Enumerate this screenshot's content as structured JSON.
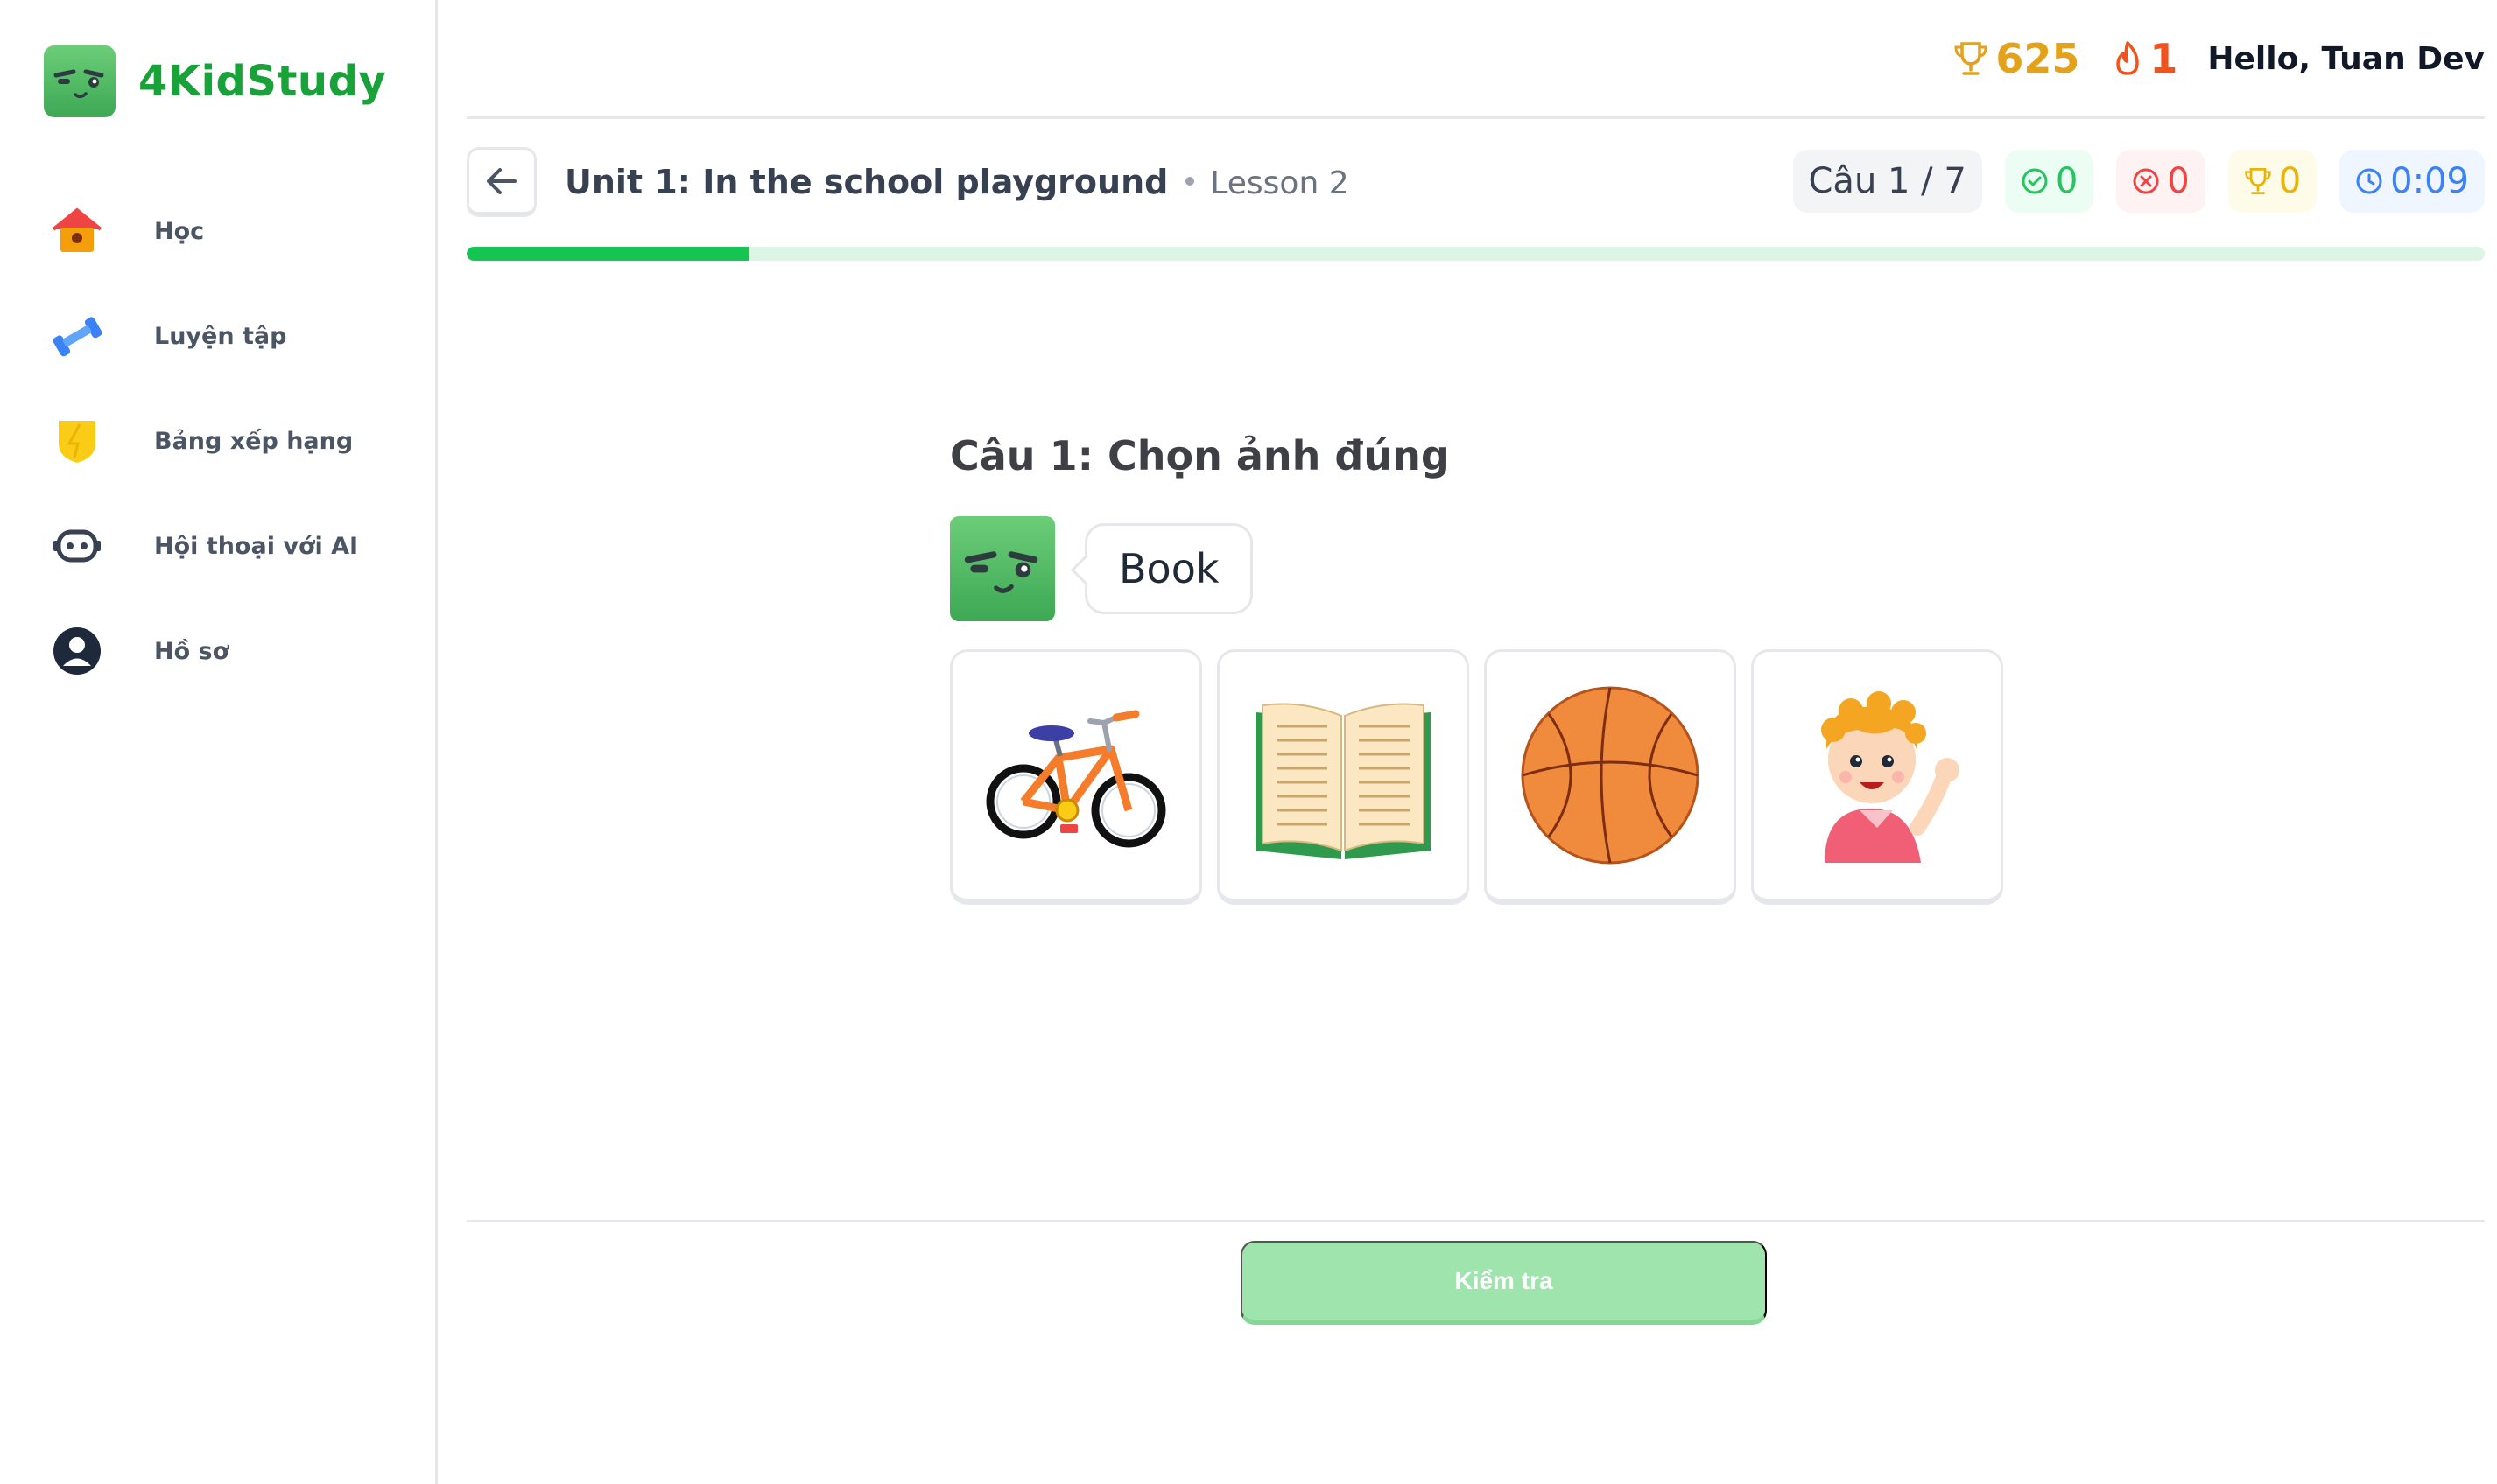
{
  "brand": {
    "name": "4KidStudy",
    "mascot_icon": "green-mascot-icon"
  },
  "sidebar": {
    "items": [
      {
        "label": "Học",
        "icon": "house-icon"
      },
      {
        "label": "Luyện tập",
        "icon": "dumbbell-icon"
      },
      {
        "label": "Bảng xếp hạng",
        "icon": "shield-icon"
      },
      {
        "label": "Hội thoại với AI",
        "icon": "robot-icon"
      },
      {
        "label": "Hồ sơ",
        "icon": "user-icon"
      }
    ]
  },
  "header": {
    "trophies": "625",
    "streak": "1",
    "greeting": "Hello, Tuan Dev"
  },
  "lesson": {
    "unit_title": "Unit 1: In the school playground",
    "lesson_name": "Lesson 2",
    "question_counter": "Câu 1 / 7",
    "correct_count": "0",
    "wrong_count": "0",
    "points": "0",
    "timer": "0:09",
    "progress": 0.14
  },
  "question": {
    "title": "Câu 1: Chọn ảnh đúng",
    "word": "Book",
    "choices": [
      {
        "icon": "bicycle-image"
      },
      {
        "icon": "open-book-image"
      },
      {
        "icon": "basketball-image"
      },
      {
        "icon": "waving-boy-image"
      }
    ]
  },
  "footer": {
    "check_label": "Kiểm tra"
  },
  "colors": {
    "brand_green": "#1aa23a",
    "progress_green": "#16c454",
    "check_button": "#9ee4ac"
  }
}
